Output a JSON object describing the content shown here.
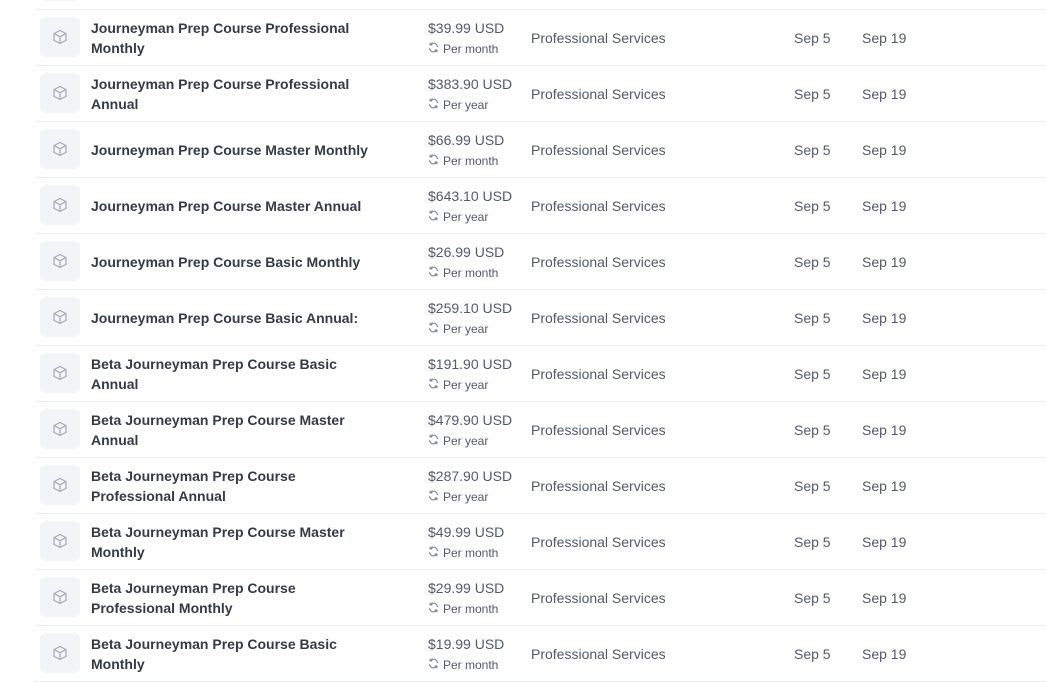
{
  "table": {
    "rows": [
      {
        "name": "",
        "price": "",
        "interval": "",
        "category": "",
        "created": "",
        "updated": ""
      },
      {
        "name": "Journeyman Prep Course Professional Monthly",
        "price": "$39.99 USD",
        "interval": "Per month",
        "category": "Professional Services",
        "created": "Sep 5",
        "updated": "Sep 19"
      },
      {
        "name": "Journeyman Prep Course Professional Annual",
        "price": "$383.90 USD",
        "interval": "Per year",
        "category": "Professional Services",
        "created": "Sep 5",
        "updated": "Sep 19"
      },
      {
        "name": "Journeyman Prep Course Master Monthly",
        "price": "$66.99 USD",
        "interval": "Per month",
        "category": "Professional Services",
        "created": "Sep 5",
        "updated": "Sep 19"
      },
      {
        "name": "Journeyman Prep Course Master Annual",
        "price": "$643.10 USD",
        "interval": "Per year",
        "category": "Professional Services",
        "created": "Sep 5",
        "updated": "Sep 19"
      },
      {
        "name": "Journeyman Prep Course Basic Monthly",
        "price": "$26.99 USD",
        "interval": "Per month",
        "category": "Professional Services",
        "created": "Sep 5",
        "updated": "Sep 19"
      },
      {
        "name": "Journeyman Prep Course Basic Annual:",
        "price": "$259.10 USD",
        "interval": "Per year",
        "category": "Professional Services",
        "created": "Sep 5",
        "updated": "Sep 19"
      },
      {
        "name": "Beta Journeyman Prep Course Basic Annual",
        "price": "$191.90 USD",
        "interval": "Per year",
        "category": "Professional Services",
        "created": "Sep 5",
        "updated": "Sep 19"
      },
      {
        "name": "Beta Journeyman Prep Course Master Annual",
        "price": "$479.90 USD",
        "interval": "Per year",
        "category": "Professional Services",
        "created": "Sep 5",
        "updated": "Sep 19"
      },
      {
        "name": "Beta Journeyman Prep Course Professional Annual",
        "price": "$287.90 USD",
        "interval": "Per year",
        "category": "Professional Services",
        "created": "Sep 5",
        "updated": "Sep 19"
      },
      {
        "name": "Beta Journeyman Prep Course Master Monthly",
        "price": "$49.99 USD",
        "interval": "Per month",
        "category": "Professional Services",
        "created": "Sep 5",
        "updated": "Sep 19"
      },
      {
        "name": "Beta Journeyman Prep Course Professional Monthly",
        "price": "$29.99 USD",
        "interval": "Per month",
        "category": "Professional Services",
        "created": "Sep 5",
        "updated": "Sep 19"
      },
      {
        "name": "Beta Journeyman Prep Course Basic Monthly",
        "price": "$19.99 USD",
        "interval": "Per month",
        "category": "Professional Services",
        "created": "Sep 5",
        "updated": "Sep 19"
      }
    ]
  },
  "icons": {
    "product_thumbnail": "cube-icon",
    "interval": "recurring-icon"
  },
  "colors": {
    "text_primary": "#353a44",
    "text_secondary": "#545969",
    "divider": "#ebeef1",
    "thumbnail_bg": "#f2f4f7",
    "icon": "#a3acba"
  }
}
